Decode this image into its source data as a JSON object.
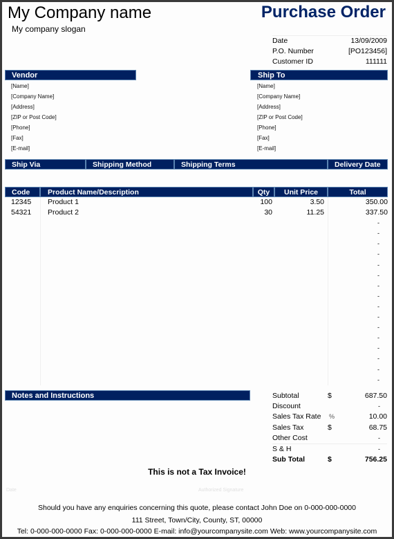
{
  "header": {
    "company_name": "My Company name",
    "slogan": "My company slogan",
    "doc_title": "Purchase Order"
  },
  "meta": [
    {
      "label": "Date",
      "value": "13/09/2009"
    },
    {
      "label": "P.O. Number",
      "value": "[PO123456]"
    },
    {
      "label": "Customer ID",
      "value": "111111"
    }
  ],
  "vendor": {
    "title": "Vendor",
    "lines": [
      "[Name]",
      "[Company Name]",
      "[Address]",
      "[ZIP or Post Code]",
      "[Phone]",
      "[Fax]",
      "[E-mail]"
    ]
  },
  "ship_to": {
    "title": "Ship To",
    "lines": [
      "[Name]",
      "[Company Name]",
      "[Address]",
      "[ZIP or Post Code]",
      "[Phone]",
      "[Fax]",
      "[E-mail]"
    ]
  },
  "shipping": {
    "headers": [
      "Ship Via",
      "Shipping Method",
      "Shipping Terms",
      "Delivery Date"
    ]
  },
  "items": {
    "headers": [
      "Code",
      "Product Name/Description",
      "Qty",
      "Unit Price",
      "Total"
    ],
    "rows": [
      {
        "code": "12345",
        "desc": "Product 1",
        "qty": "100",
        "price": "3.50",
        "total": "350.00"
      },
      {
        "code": "54321",
        "desc": "Product 2",
        "qty": "30",
        "price": "11.25",
        "total": "337.50"
      }
    ],
    "empty_rows": 16,
    "empty_total": "-"
  },
  "notes": {
    "title": "Notes and Instructions"
  },
  "totals": [
    {
      "label": "Subtotal",
      "sym": "$",
      "value": "687.50"
    },
    {
      "label": "Discount",
      "sym": "",
      "value": "-"
    },
    {
      "label": "Sales Tax Rate",
      "sym": "%",
      "value": "10.00"
    },
    {
      "label": "Sales Tax",
      "sym": "$",
      "value": "68.75"
    },
    {
      "label": "Other Cost",
      "sym": "",
      "value": "-"
    },
    {
      "label": "S & H",
      "sym": "",
      "value": "-"
    },
    {
      "label": "Sub Total",
      "sym": "$",
      "value": "756.25",
      "bold": true
    }
  ],
  "notice": "This is not a Tax Invoice!",
  "signature": {
    "date_label": "Date",
    "auth_label": "Authorized Signature"
  },
  "footer": {
    "line1": "Should you have any enquiries concerning this quote, please contact John Doe on 0-000-000-0000",
    "line2": "111 Street, Town/City, County, ST, 00000",
    "line3": "Tel: 0-000-000-0000 Fax: 0-000-000-0000 E-mail: info@yourcompanysite.com Web: www.yourcompanysite.com"
  }
}
